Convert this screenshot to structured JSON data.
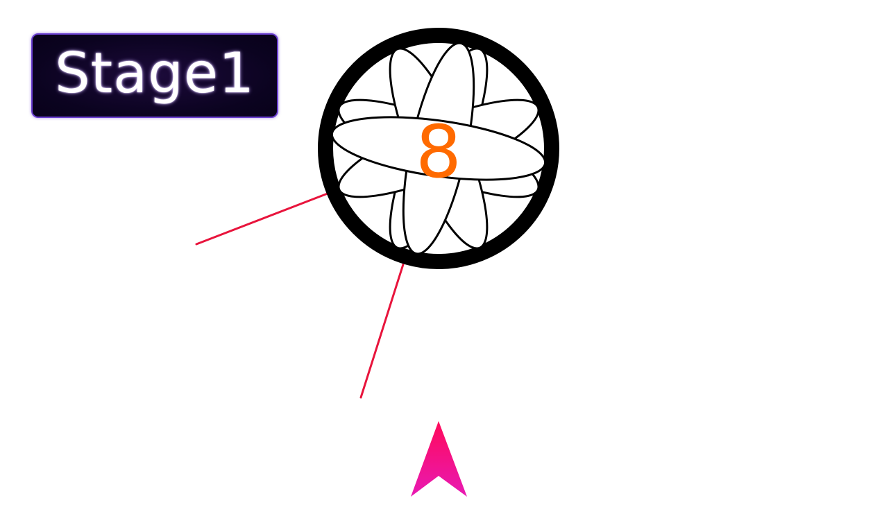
{
  "stage": {
    "label": "Stage1"
  },
  "target": {
    "count": "8",
    "count_color": "#ff6a00"
  },
  "colors": {
    "needle": "#e8143c",
    "launcher_top": "#ff0a5a",
    "launcher_bottom": "#e81ab4",
    "badge_border": "#6a3fd0",
    "target_ring": "#000000"
  },
  "icons": {
    "target": "flower-wheel-icon",
    "launcher": "arrowhead-launcher-icon"
  }
}
